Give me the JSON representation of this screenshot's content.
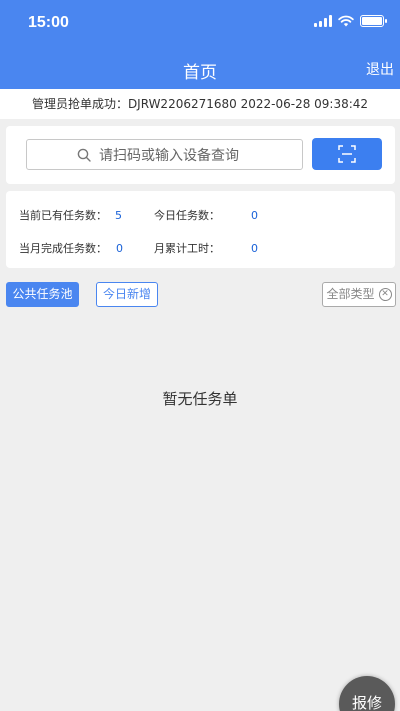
{
  "status_bar": {
    "time": "15:00"
  },
  "nav": {
    "title": "首页",
    "logout_label": "退出"
  },
  "notice": {
    "text": "管理员抢单成功：DJRW2206271680 2022-06-28 09:38:42"
  },
  "search": {
    "placeholder": "请扫码或输入设备查询",
    "search_icon": "search-icon",
    "scan_icon": "scan-icon"
  },
  "stats": {
    "current_tasks": {
      "label": "当前已有任务数：",
      "value": "5"
    },
    "today_tasks": {
      "label": "今日任务数：",
      "value": "0"
    },
    "month_completed": {
      "label": "当月完成任务数：",
      "value": "0"
    },
    "month_hours": {
      "label": "月累计工时：",
      "value": "0"
    }
  },
  "filters": {
    "public_pool": "公共任务池",
    "today_new": "今日新增",
    "all_types": "全部类型",
    "clear_icon": "close-circle-icon"
  },
  "empty_state": {
    "text": "暂无任务单"
  },
  "fab": {
    "label": "报修"
  },
  "colors": {
    "primary": "#4a86f0",
    "button": "#3c7ff0",
    "value": "#1a62d8",
    "background": "#efefef"
  }
}
